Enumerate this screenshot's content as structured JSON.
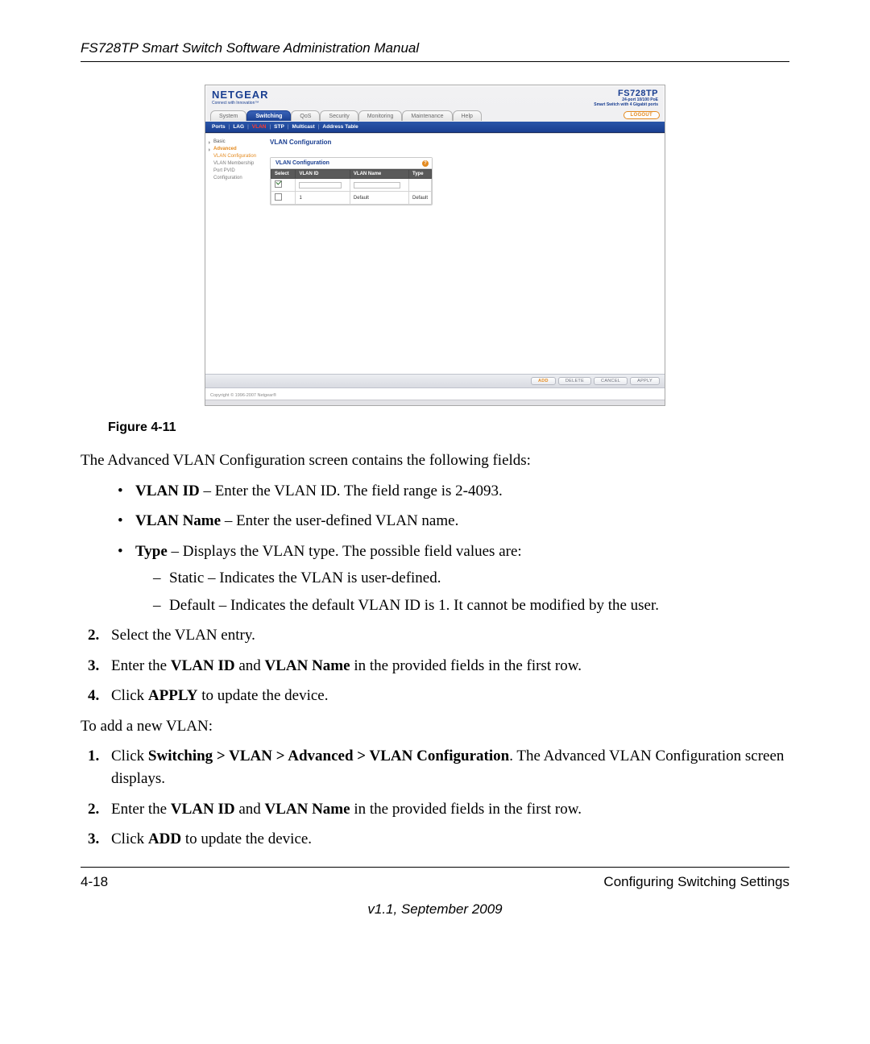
{
  "header": {
    "title": "FS728TP Smart Switch Software Administration Manual"
  },
  "ui": {
    "logo": {
      "brand": "NETGEAR",
      "tagline": "Connect with Innovation™"
    },
    "model": {
      "code": "FS728TP",
      "desc1": "24-port 10/100 PoE",
      "desc2": "Smart Switch with 4 Gigabit ports"
    },
    "nav": {
      "tabs": [
        "System",
        "Switching",
        "QoS",
        "Security",
        "Monitoring",
        "Maintenance",
        "Help"
      ],
      "active": "Switching",
      "logout": "LOGOUT"
    },
    "subnav": {
      "items": [
        "Ports",
        "LAG",
        "VLAN",
        "STP",
        "Multicast",
        "Address Table"
      ],
      "selected": "VLAN"
    },
    "side": {
      "basic": "Basic",
      "advanced": "Advanced",
      "items": [
        "VLAN Configuration",
        "VLAN Membership",
        "Port PVID Configuration"
      ],
      "selected": "VLAN Configuration"
    },
    "panel": {
      "pageTitle": "VLAN Configuration",
      "title": "VLAN Configuration",
      "help": "?",
      "headers": {
        "select": "Select",
        "vlanId": "VLAN ID",
        "vlanName": "VLAN Name",
        "type": "Type"
      },
      "input": {
        "vlanId": "",
        "vlanName": "",
        "checked": true
      },
      "row1": {
        "vlanId": "1",
        "vlanName": "Default",
        "type": "Default",
        "checked": false
      }
    },
    "actions": {
      "add": "ADD",
      "delete": "DELETE",
      "cancel": "CANCEL",
      "apply": "APPLY"
    },
    "copyright": "Copyright © 1996-2007 Netgear®"
  },
  "figure": {
    "caption": "Figure 4-11"
  },
  "body": {
    "intro": "The Advanced VLAN Configuration screen contains the following fields:",
    "fields": {
      "vlanId": {
        "label": "VLAN ID",
        "text": " – Enter the VLAN ID. The field range is 2-4093."
      },
      "vlanName": {
        "label": "VLAN Name",
        "text": " – Enter the user-defined VLAN name."
      },
      "type": {
        "label": "Type",
        "text": " – Displays the VLAN type. The possible field values are:",
        "sub": {
          "static": "Static – Indicates the VLAN is user-defined.",
          "default": "Default – Indicates the default VLAN ID is 1. It cannot be modified by the user."
        }
      }
    },
    "stepsA": {
      "s2": "Select the VLAN entry.",
      "s3_pre": "Enter the ",
      "s3_b1": "VLAN ID",
      "s3_mid": " and ",
      "s3_b2": "VLAN Name",
      "s3_post": " in the provided fields in the first row.",
      "s4_pre": "Click ",
      "s4_b": "APPLY",
      "s4_post": " to update the device."
    },
    "addIntro": "To add a new VLAN:",
    "stepsB": {
      "s1_pre": "Click ",
      "s1_b": "Switching > VLAN > Advanced > VLAN Configuration",
      "s1_post": ". The Advanced VLAN Configuration screen displays.",
      "s2_pre": "Enter the ",
      "s2_b1": "VLAN ID",
      "s2_mid": " and ",
      "s2_b2": "VLAN Name",
      "s2_post": " in the provided fields in the first row.",
      "s3_pre": "Click ",
      "s3_b": "ADD",
      "s3_post": " to update the device."
    }
  },
  "footer": {
    "pageNum": "4-18",
    "section": "Configuring Switching Settings",
    "version": "v1.1, September 2009"
  }
}
